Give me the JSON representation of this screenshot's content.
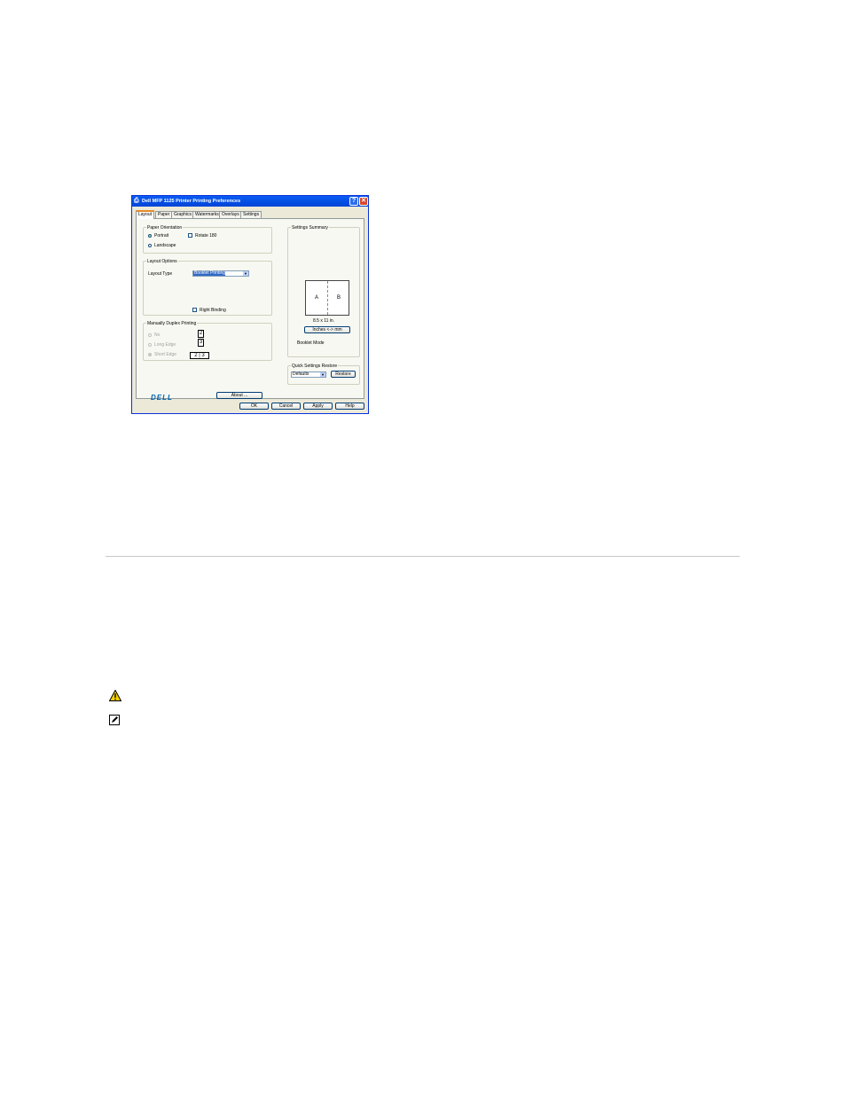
{
  "dialog": {
    "title": "Dell MFP 1125 Printer Printing Preferences",
    "help_btn": "?",
    "close_btn": "✕",
    "tabs": [
      "Layout",
      "Paper",
      "Graphics",
      "Watermarks",
      "Overlays",
      "Settings"
    ],
    "paper_orientation": {
      "label": "Paper Orientation",
      "portrait": "Portrait",
      "landscape": "Landscape",
      "rotate": "Rotate 180"
    },
    "layout_options": {
      "label": "Layout Options",
      "layout_type_label": "Layout Type",
      "layout_type_value": "Booklet Printing",
      "right_binding": "Right Binding"
    },
    "duplex": {
      "label": "Manually Duplex Printing",
      "none": "No",
      "long_edge": "Long Edge",
      "short_edge": "Short Edge",
      "box_a": "2",
      "box_b": "3",
      "box_c": "2 | 3"
    },
    "logo": "DELL",
    "about_btn": "About ...",
    "summary": {
      "label": "Settings Summary",
      "page_a": "A",
      "page_b": "B",
      "paper_size": "8.5 x 11 in.",
      "units_btn": "Inches <-> mm",
      "mode": "Booklet Mode"
    },
    "quick": {
      "label": "Quick Settings Restore",
      "value": "Defaults",
      "restore_btn": "Restore"
    },
    "footer": {
      "ok": "OK",
      "cancel": "Cancel",
      "apply": "Apply",
      "help": "Help"
    }
  },
  "colors": {
    "titlebar": "#0a5cf4",
    "dialog_bg": "#ece9d8",
    "selection": "#316ac5",
    "separator": "#c8c8c8",
    "warning": "#f5d000"
  },
  "icons": [
    "caution-icon",
    "note-icon"
  ]
}
